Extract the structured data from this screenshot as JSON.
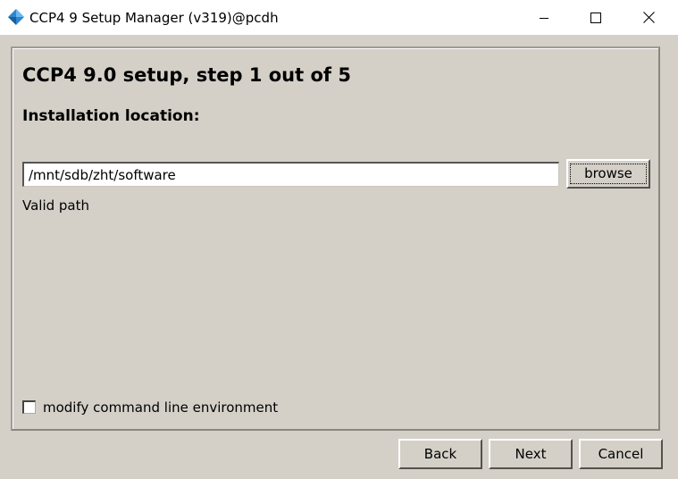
{
  "window": {
    "title": "CCP4 9 Setup Manager (v319)@pcdh",
    "icon": "ccp4-diamond-icon",
    "controls": [
      "minimize-icon",
      "maximize-icon",
      "close-icon"
    ]
  },
  "main": {
    "heading": "CCP4 9.0 setup, step 1 out of 5",
    "section_label": "Installation location:",
    "path_value": "/mnt/sdb/zht/software",
    "browse_label": "browse",
    "status": "Valid path",
    "env_checkbox": {
      "label": "modify command line environment",
      "checked": false
    }
  },
  "footer": {
    "back_label": "Back",
    "next_label": "Next",
    "cancel_label": "Cancel"
  },
  "colors": {
    "dialog_bg": "#d4d0c8",
    "titlebar_bg": "#ffffff",
    "icon_blue": "#2e86d0"
  }
}
